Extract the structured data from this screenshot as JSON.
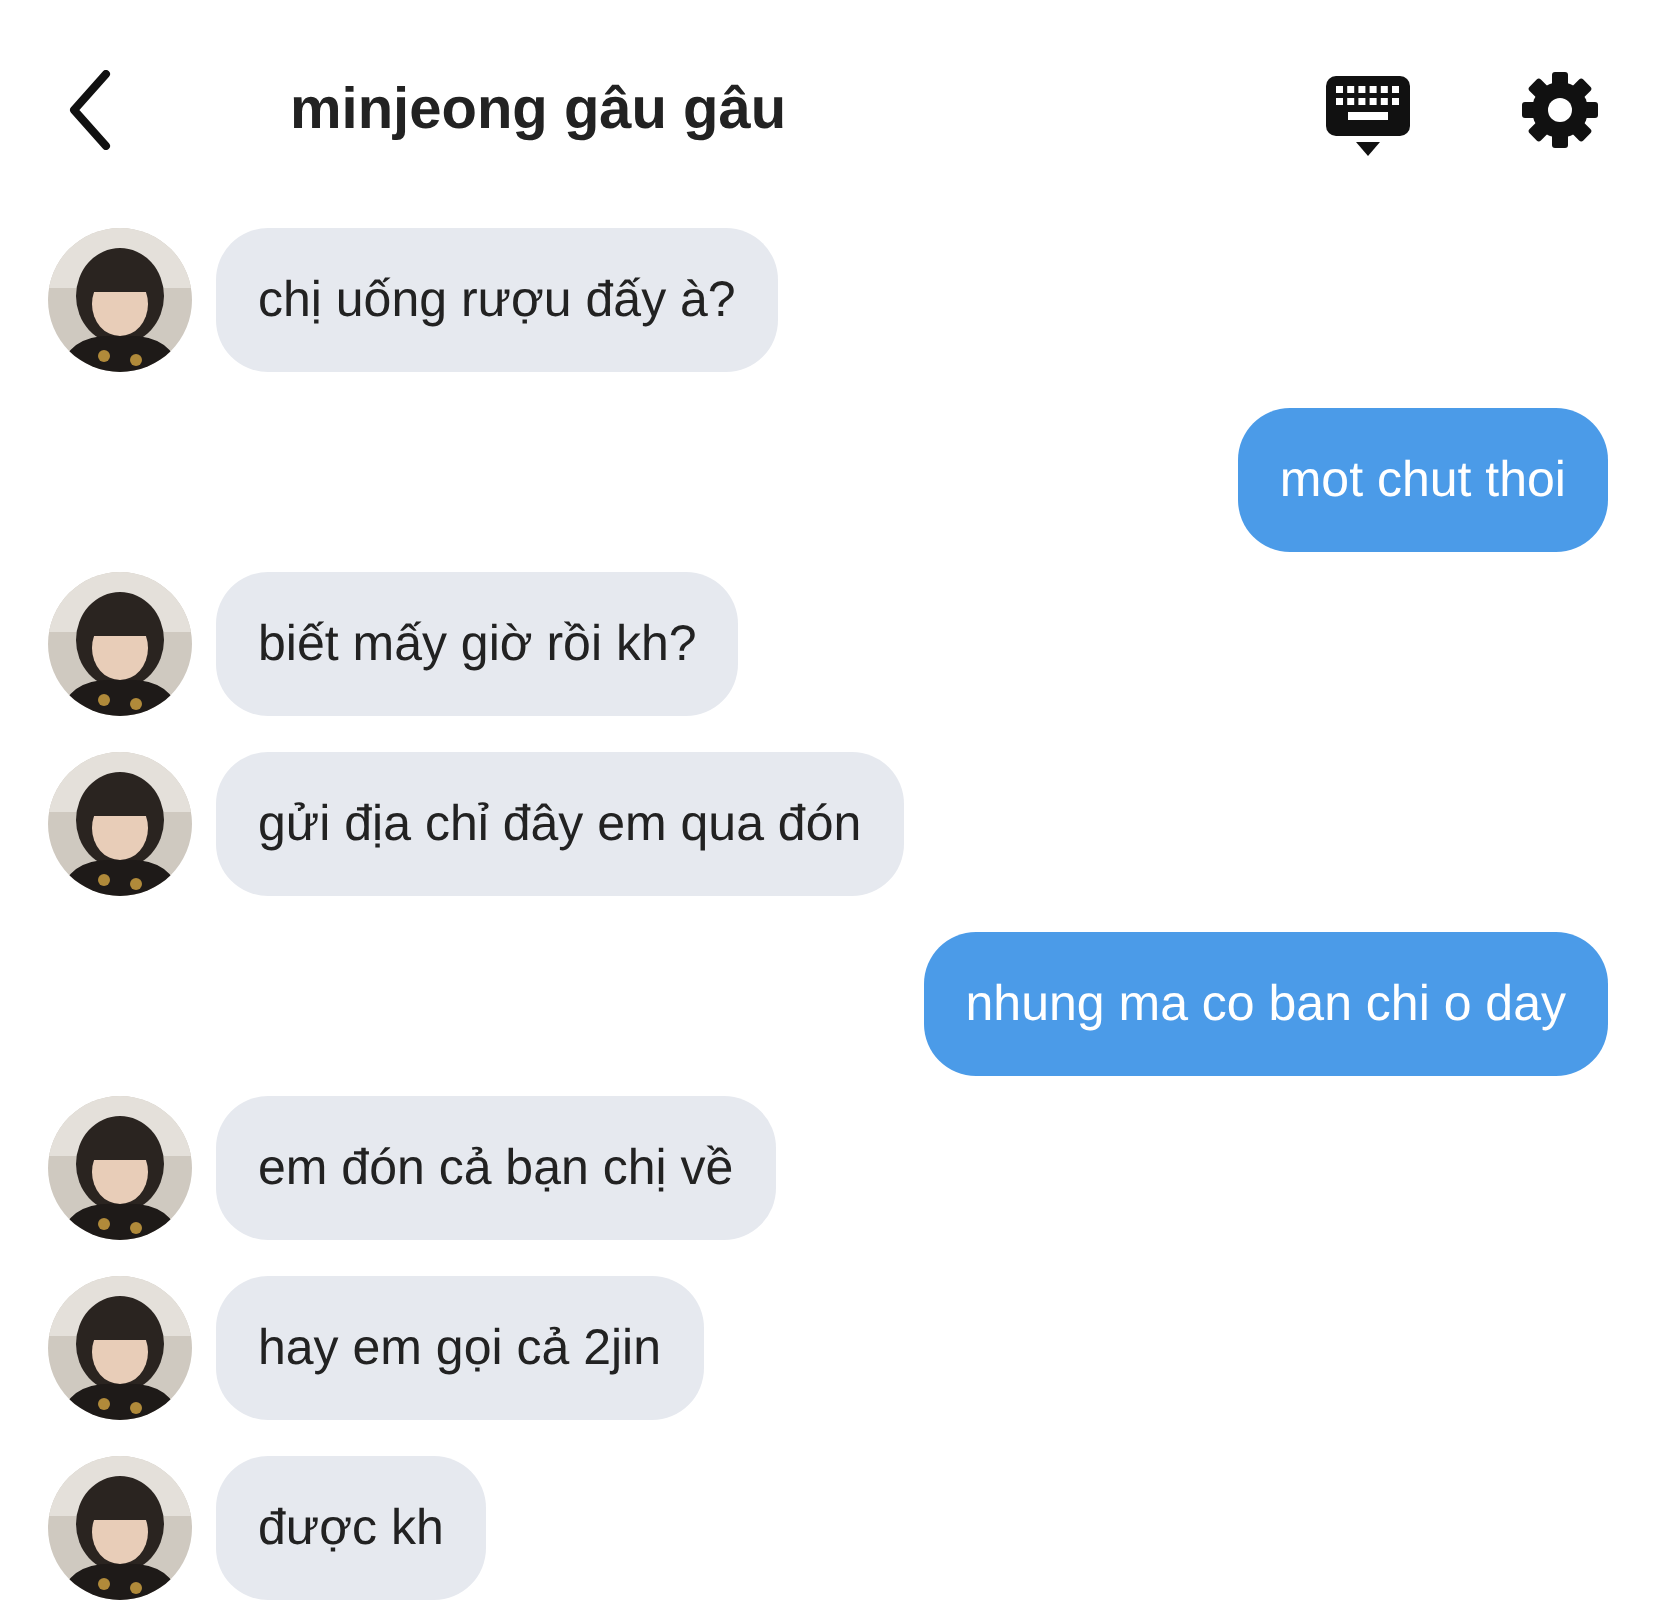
{
  "header": {
    "title": "minjeong gâu gâu"
  },
  "messages": [
    {
      "kind": "incoming",
      "text": "chị uống rượu đấy à?"
    },
    {
      "kind": "outgoing",
      "text": "mot chut thoi"
    },
    {
      "kind": "incoming",
      "text": "biết mấy giờ rồi kh?"
    },
    {
      "kind": "incoming",
      "text": "gửi địa chỉ đây em qua đón"
    },
    {
      "kind": "outgoing",
      "text": "nhung ma co ban chi o day"
    },
    {
      "kind": "incoming",
      "text": "em đón cả bạn chị về"
    },
    {
      "kind": "incoming",
      "text": "hay em gọi cả 2jin"
    },
    {
      "kind": "incoming",
      "text": "được kh"
    }
  ]
}
